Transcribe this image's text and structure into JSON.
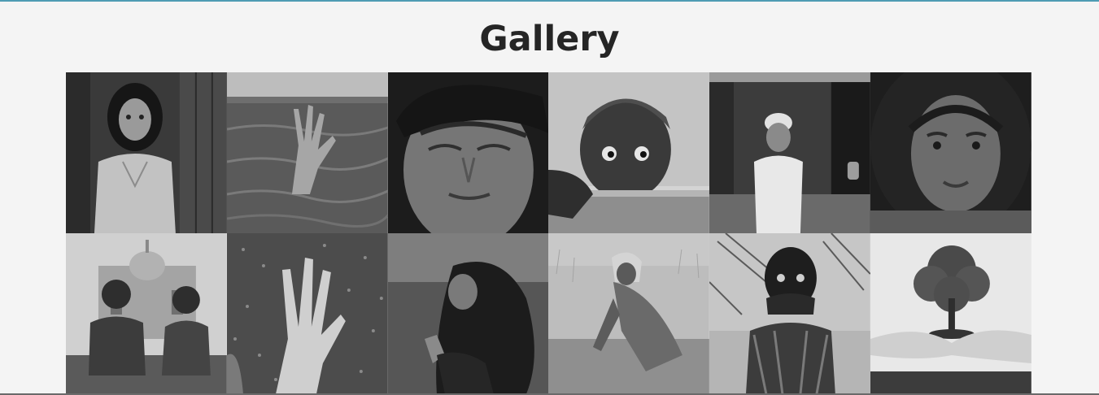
{
  "page": {
    "title": "Gallery"
  },
  "gallery": {
    "items": [
      {
        "subject": "girl-by-wooden-door",
        "tone": "dark"
      },
      {
        "subject": "hand-reaching-from-water",
        "tone": "mid"
      },
      {
        "subject": "boy-with-tear",
        "tone": "dark"
      },
      {
        "subject": "boy-peering-over-pipe",
        "tone": "light"
      },
      {
        "subject": "old-man-by-hut",
        "tone": "dark"
      },
      {
        "subject": "girl-with-curly-hair",
        "tone": "dark"
      },
      {
        "subject": "children-before-monument",
        "tone": "light"
      },
      {
        "subject": "hand-on-rainy-glass",
        "tone": "mid"
      },
      {
        "subject": "girl-looking-up",
        "tone": "dark"
      },
      {
        "subject": "woman-working-in-field",
        "tone": "light"
      },
      {
        "subject": "child-covering-mouth",
        "tone": "light"
      },
      {
        "subject": "tree-in-cupped-hands",
        "tone": "light"
      }
    ]
  }
}
